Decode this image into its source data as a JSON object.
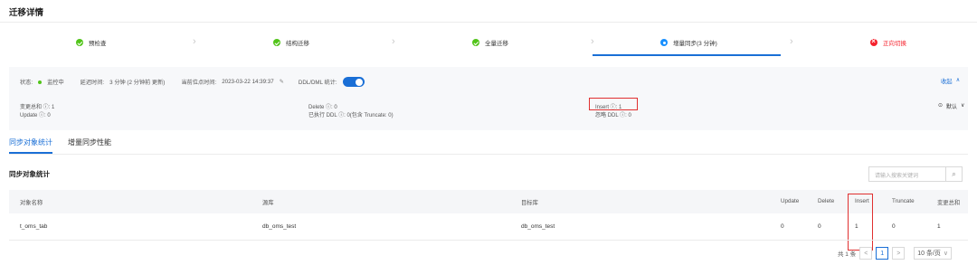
{
  "page_title": "迁移详情",
  "steps": [
    {
      "label": "预检查",
      "state": "ok"
    },
    {
      "label": "结构迁移",
      "state": "ok"
    },
    {
      "label": "全量迁移",
      "state": "ok"
    },
    {
      "label": "增量同步(3 分钟)",
      "state": "running"
    },
    {
      "label": "正向切换",
      "state": "error"
    }
  ],
  "status_bar": {
    "status_label": "状态:",
    "status_value": "监控中",
    "delay_label": "延迟时间:",
    "delay_value": "3 分钟 (2 分钟前 更新)",
    "checkpoint_label": "当前位点时间:",
    "checkpoint_value": "2023-03-22 14:39:37",
    "ddl_label": "DDL/DML 统计:",
    "ddl_toggle_on": true,
    "collapse_label": "收起"
  },
  "stats": {
    "change_total": "变更总和 ⓘ: 1",
    "update": "Update ⓘ: 0",
    "delete": "Delete ⓘ: 0",
    "executed_ddl": "已执行 DDL ⓘ: 0(包含 Truncate: 0)",
    "insert": "Insert ⓘ: 1",
    "ignored_ddl": "忽略 DDL ⓘ: 0",
    "default_label": "默认"
  },
  "tabs": [
    {
      "label": "同步对象统计",
      "active": true
    },
    {
      "label": "增量同步性能",
      "active": false
    }
  ],
  "section_title": "同步对象统计",
  "search_placeholder": "请输入搜索关键词",
  "table": {
    "columns": [
      "对象名称",
      "源库",
      "目标库",
      "Update",
      "Delete",
      "Insert",
      "Truncate",
      "变更总和"
    ],
    "rows": [
      [
        "t_oms_tab",
        "db_oms_test",
        "db_oms_test",
        "0",
        "0",
        "1",
        "0",
        "1"
      ]
    ]
  },
  "pagination": {
    "total": "共 1 条",
    "prev": "<",
    "current": "1",
    "next": ">",
    "page_size": "10 条/页"
  },
  "colors": {
    "accent": "#1a6fd6",
    "success": "#52c41a",
    "error": "#f5222d",
    "highlight_box": "#e03030"
  }
}
